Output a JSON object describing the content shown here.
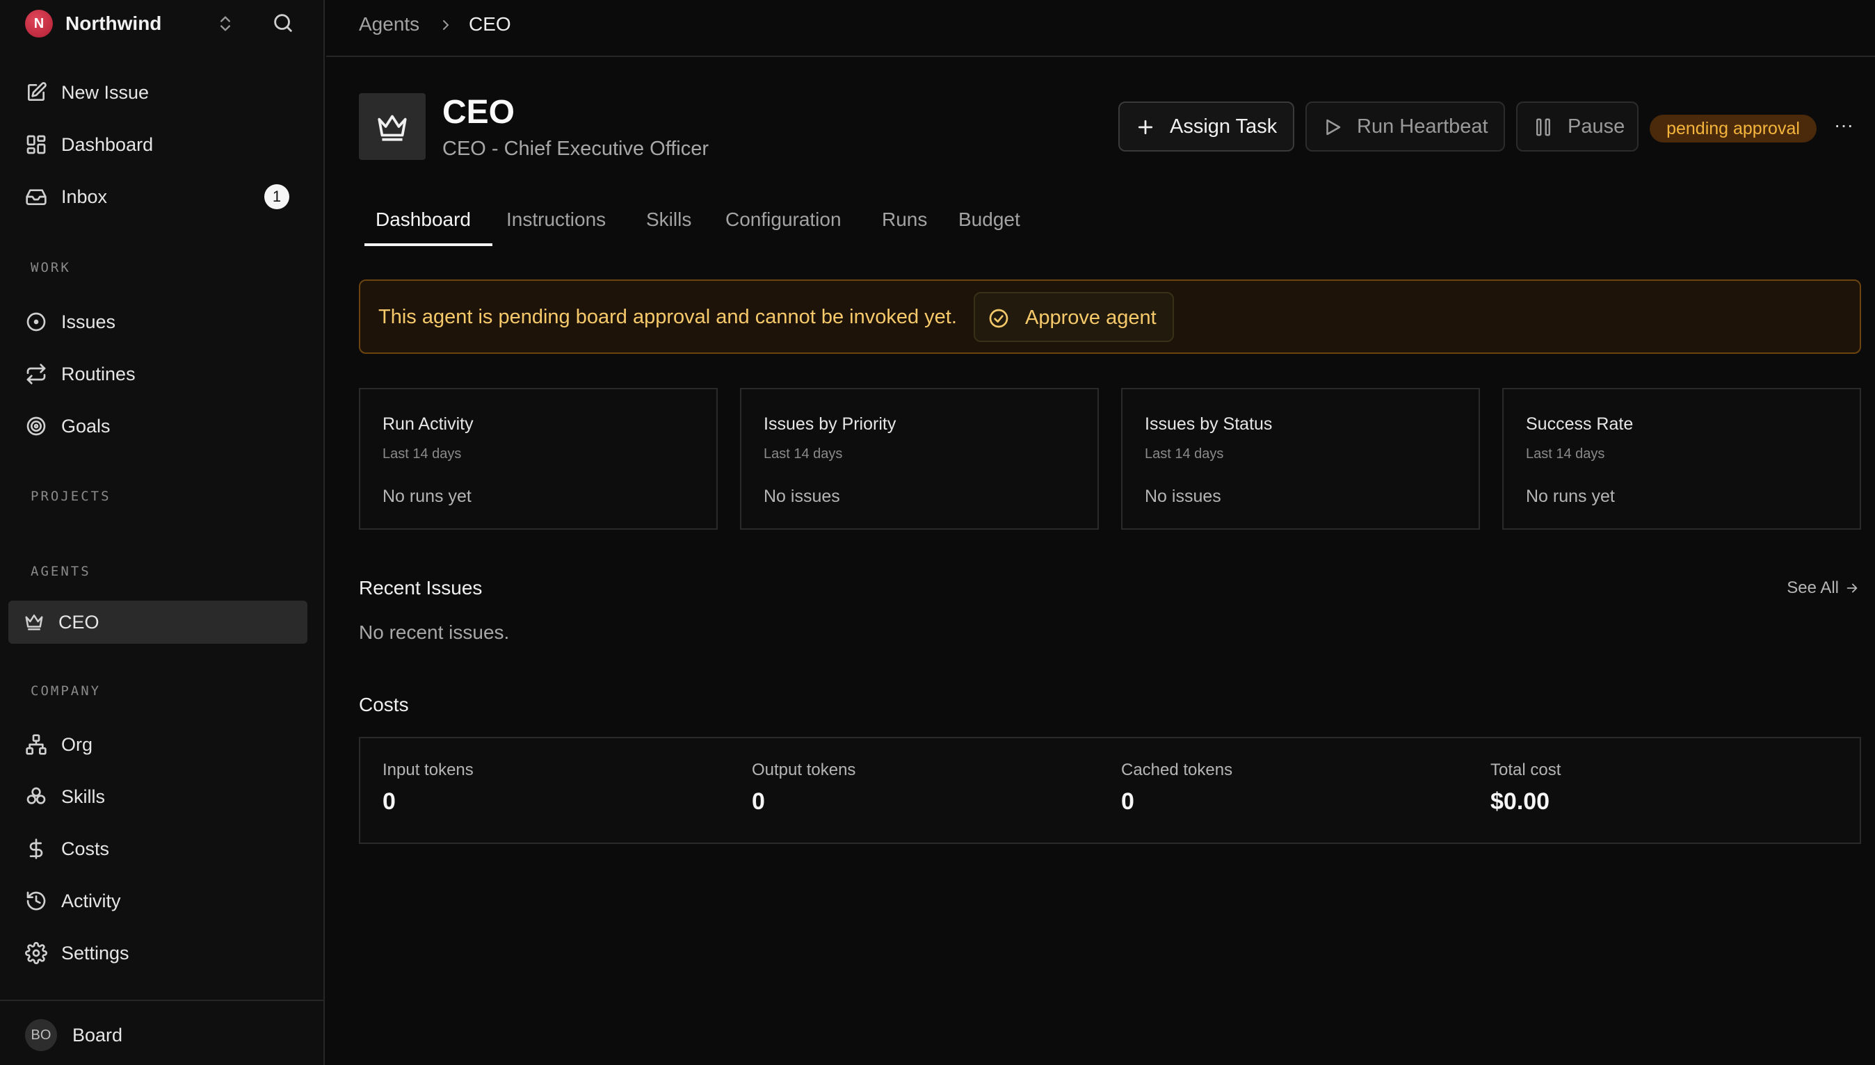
{
  "sidebar": {
    "company": {
      "name": "Northwind",
      "logo_letter": "N",
      "logo_color": "#c8283e"
    },
    "nav_main": [
      {
        "label": "New Issue",
        "icon": "pencil-square-icon"
      },
      {
        "label": "Dashboard",
        "icon": "dashboard-grid-icon"
      },
      {
        "label": "Inbox",
        "icon": "inbox-icon",
        "badge": "1"
      }
    ],
    "sections": {
      "work": "WORK",
      "projects": "PROJECTS",
      "agents": "AGENTS",
      "company": "COMPANY"
    },
    "work_items": [
      {
        "label": "Issues",
        "icon": "circle-dot-icon"
      },
      {
        "label": "Routines",
        "icon": "repeat-icon"
      },
      {
        "label": "Goals",
        "icon": "target-icon"
      }
    ],
    "agent_items": [
      {
        "label": "CEO",
        "icon": "crown-icon",
        "active": true
      }
    ],
    "company_items": [
      {
        "label": "Org",
        "icon": "org-chart-icon"
      },
      {
        "label": "Skills",
        "icon": "skills-icon"
      },
      {
        "label": "Costs",
        "icon": "dollar-icon"
      },
      {
        "label": "Activity",
        "icon": "history-icon"
      },
      {
        "label": "Settings",
        "icon": "gear-icon"
      }
    ],
    "footer": {
      "avatar": "BO",
      "name": "Board"
    }
  },
  "breadcrumb": {
    "parent": "Agents",
    "current": "CEO"
  },
  "agent": {
    "name": "CEO",
    "subtitle": "CEO - Chief Executive Officer",
    "icon": "crown-icon",
    "status": "pending approval",
    "status_color": "#f5b53d"
  },
  "actions": {
    "assign": "Assign Task",
    "run": "Run Heartbeat",
    "pause": "Pause",
    "more": "···"
  },
  "tabs": [
    "Dashboard",
    "Instructions",
    "Skills",
    "Configuration",
    "Runs",
    "Budget"
  ],
  "active_tab": "Dashboard",
  "banner": {
    "text": "This agent is pending board approval and cannot be invoked yet.",
    "button": "Approve agent",
    "accent_color": "#f6c96a"
  },
  "cards": [
    {
      "title": "Run Activity",
      "subtitle": "Last 14 days",
      "empty": "No runs yet"
    },
    {
      "title": "Issues by Priority",
      "subtitle": "Last 14 days",
      "empty": "No issues"
    },
    {
      "title": "Issues by Status",
      "subtitle": "Last 14 days",
      "empty": "No issues"
    },
    {
      "title": "Success Rate",
      "subtitle": "Last 14 days",
      "empty": "No runs yet"
    }
  ],
  "recent_issues": {
    "title": "Recent Issues",
    "see_all": "See All",
    "empty": "No recent issues."
  },
  "costs": {
    "title": "Costs",
    "items": [
      {
        "label": "Input tokens",
        "value": "0"
      },
      {
        "label": "Output tokens",
        "value": "0"
      },
      {
        "label": "Cached tokens",
        "value": "0"
      },
      {
        "label": "Total cost",
        "value": "$0.00"
      }
    ]
  }
}
